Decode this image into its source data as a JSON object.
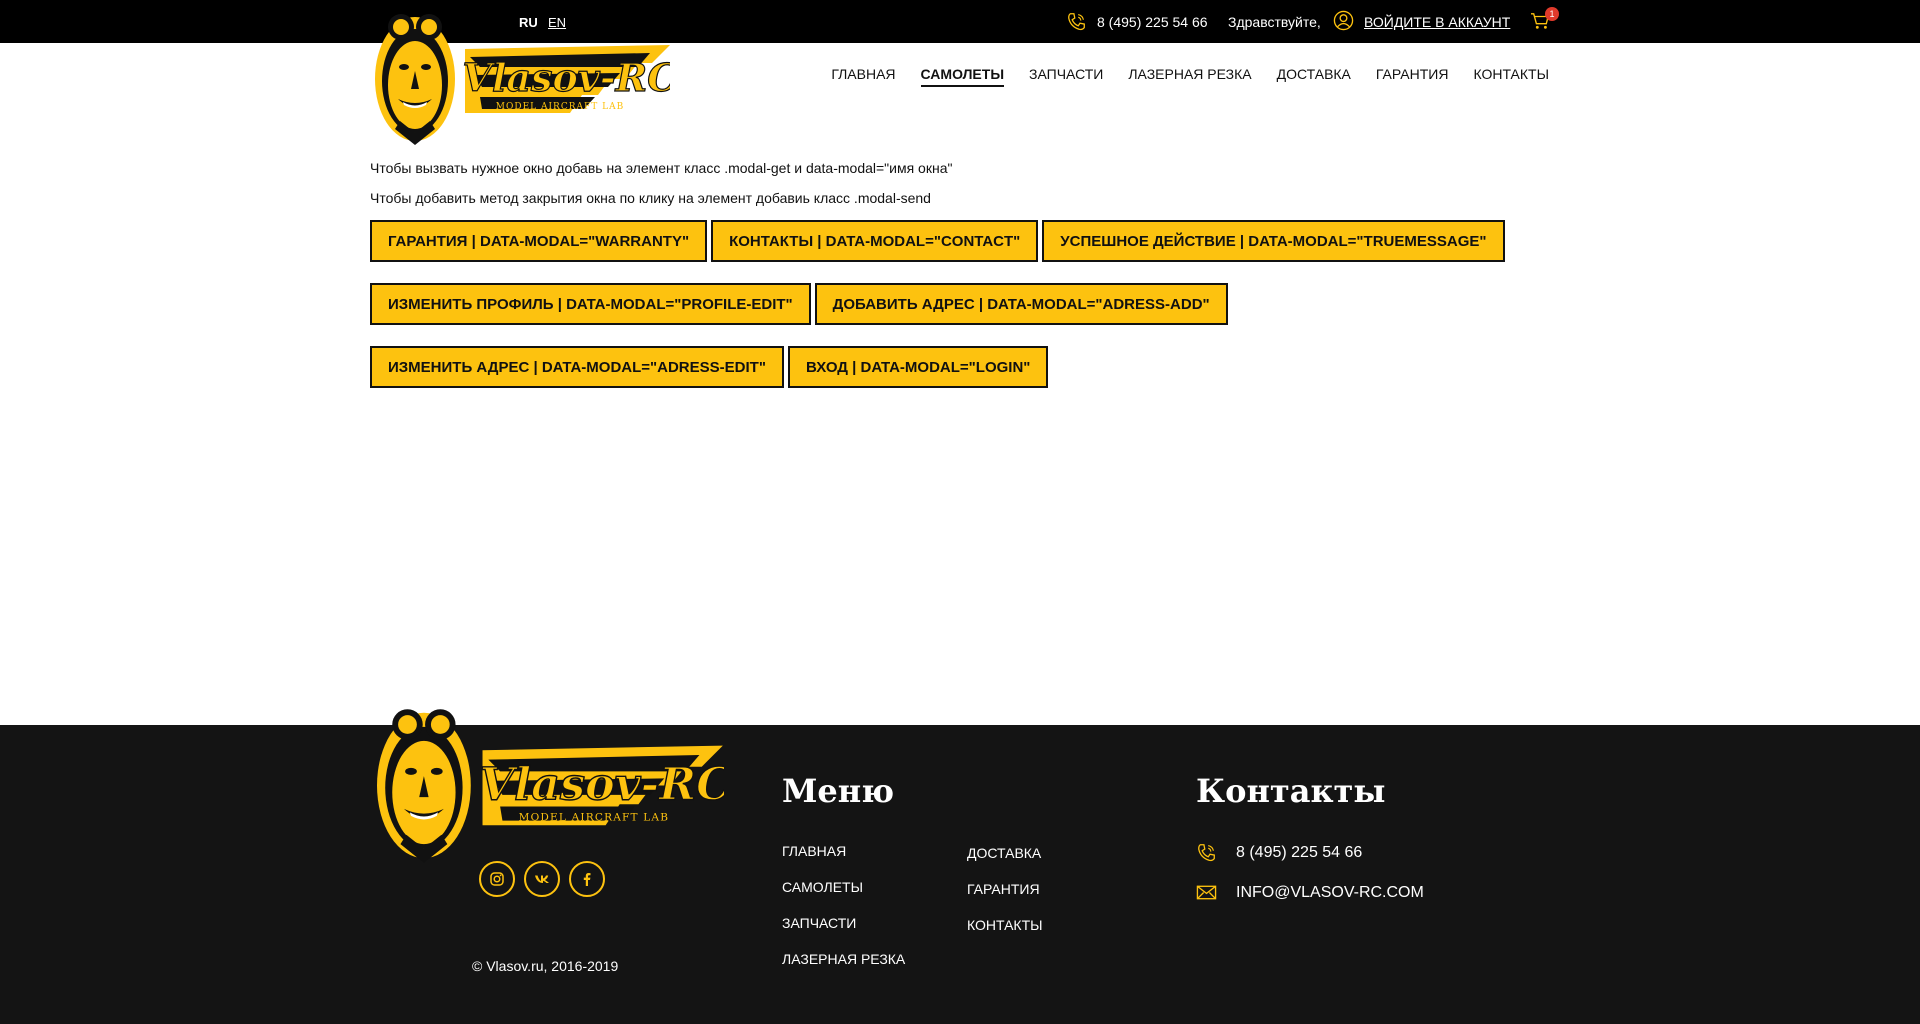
{
  "topbar": {
    "lang_ru": "RU",
    "lang_en": "EN",
    "phone": "8 (495) 225 54 66",
    "greeting": "Здравствуйте,",
    "login_link": "ВОЙДИТЕ В АККАУНТ",
    "cart_count": "1"
  },
  "logo": {
    "brand": "Vlasov-RC",
    "tagline": "MODEL AIRCRAFT LAB"
  },
  "nav": {
    "items": [
      "ГЛАВНАЯ",
      "САМОЛЕТЫ",
      "ЗАПЧАСТИ",
      "ЛАЗЕРНАЯ РЕЗКА",
      "ДОСТАВКА",
      "ГАРАНТИЯ",
      "КОНТАКТЫ"
    ],
    "active": "САМОЛЕТЫ"
  },
  "content": {
    "note1": "Чтобы вызвать нужное окно добавь на элемент класс .modal-get и data-modal=\"имя окна\"",
    "note2": "Чтобы добавить метод закрытия окна по клику на элемент добавиь класс .modal-send",
    "buttons": [
      "ГАРАНТИЯ | DATA-MODAL=\"WARRANTY\"",
      "КОНТАКТЫ | DATA-MODAL=\"CONTACT\"",
      "УСПЕШНОЕ ДЕЙСТВИЕ | DATA-MODAL=\"TRUEMESSAGE\"",
      "ИЗМЕНИТЬ ПРОФИЛЬ | DATA-MODAL=\"PROFILE-EDIT\"",
      "ДОБАВИТЬ АДРЕС | DATA-MODAL=\"ADRESS-ADD\"",
      "ИЗМЕНИТЬ АДРЕС | DATA-MODAL=\"ADRESS-EDIT\"",
      "ВХОД | DATA-MODAL=\"LOGIN\""
    ]
  },
  "footer": {
    "copyright": "© Vlasov.ru, 2016-2019",
    "menu_title": "Меню",
    "menu_col1": [
      "ГЛАВНАЯ",
      "САМОЛЕТЫ",
      "ЗАПЧАСТИ",
      "ЛАЗЕРНАЯ РЕЗКА"
    ],
    "menu_col2": [
      "ДОСТАВКА",
      "ГАРАНТИЯ",
      "КОНТАКТЫ"
    ],
    "contacts_title": "Контакты",
    "phone": "8 (495) 225 54 66",
    "email": "INFO@VLASOV-RC.COM",
    "socials": [
      "instagram-icon",
      "vk-icon",
      "facebook-icon"
    ]
  },
  "colors": {
    "accent": "#fdc20f",
    "dark": "#141414",
    "badge": "#e03a2b"
  }
}
